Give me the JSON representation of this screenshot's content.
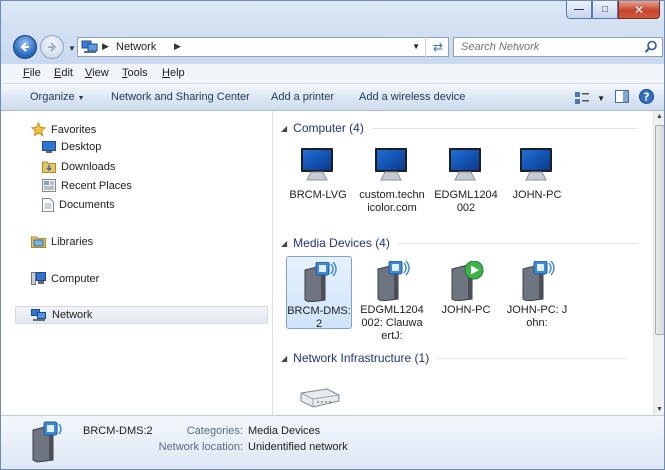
{
  "window": {
    "caption_buttons": [
      "minimize",
      "maximize",
      "close"
    ]
  },
  "address": {
    "crumb": "Network",
    "search_placeholder": "Search Network"
  },
  "menu": [
    "File",
    "Edit",
    "View",
    "Tools",
    "Help"
  ],
  "commands": {
    "organize": "Organize",
    "network_sharing": "Network and Sharing Center",
    "add_printer": "Add a printer",
    "add_wireless": "Add a wireless device"
  },
  "sidebar": {
    "favorites": "Favorites",
    "desktop": "Desktop",
    "downloads": "Downloads",
    "recent": "Recent Places",
    "documents": "Documents",
    "libraries": "Libraries",
    "computer": "Computer",
    "network": "Network"
  },
  "groups": {
    "computer": {
      "title": "Computer (4)",
      "items": [
        "BRCM-LVG",
        "custom.technicolor.com",
        "EDGML1204002",
        "JOHN-PC"
      ]
    },
    "media": {
      "title": "Media Devices (4)",
      "items": [
        "BRCM-DMS:2",
        "EDGML1204002: ClauwaertJ:",
        "JOHN-PC",
        "JOHN-PC: John:"
      ]
    },
    "infra": {
      "title": "Network Infrastructure (1)"
    }
  },
  "details": {
    "name": "BRCM-DMS:2",
    "categories_label": "Categories:",
    "categories_value": "Media Devices",
    "location_label": "Network location:",
    "location_value": "Unidentified network"
  },
  "colors": {
    "group_title": "#1e3287",
    "selection": "#cfe4fa",
    "accent": "#2d6fc4"
  }
}
